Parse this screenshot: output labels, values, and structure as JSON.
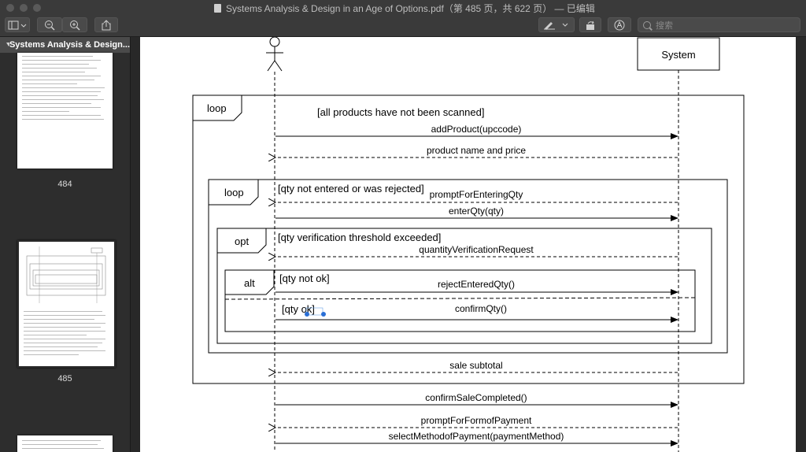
{
  "window": {
    "title": "Systems Analysis & Design in an Age of Options.pdf（第 485 页，共 622 页） — 已编辑"
  },
  "toolbar": {
    "search_placeholder": "搜索"
  },
  "sidebar": {
    "header": "Systems Analysis & Design...",
    "pages": [
      {
        "label": "484"
      },
      {
        "label": "485"
      }
    ]
  },
  "diagram": {
    "participants": {
      "system": "System"
    },
    "loop_outer": {
      "keyword": "loop",
      "guard": "[all products have not been scanned]"
    },
    "loop_inner": {
      "keyword": "loop",
      "guard": "[qty not entered or was rejected]"
    },
    "opt": {
      "keyword": "opt",
      "guard": "[qty verification threshold exceeded]"
    },
    "alt": {
      "keyword": "alt",
      "guard1": "[qty not ok]",
      "guard2": "[qty ok]"
    },
    "messages": {
      "m1": "addProduct(upccode)",
      "m2": "product name and price",
      "m3": "promptForEnteringQty",
      "m4": "enterQty(qty)",
      "m5": "quantityVerificationRequest",
      "m6": "rejectEnteredQty()",
      "m7": "confirmQty()",
      "m8": "sale subtotal",
      "m9": "confirmSaleCompleted()",
      "m10": "promptForFormofPayment",
      "m11": "selectMethodofPayment(paymentMethod)"
    }
  }
}
